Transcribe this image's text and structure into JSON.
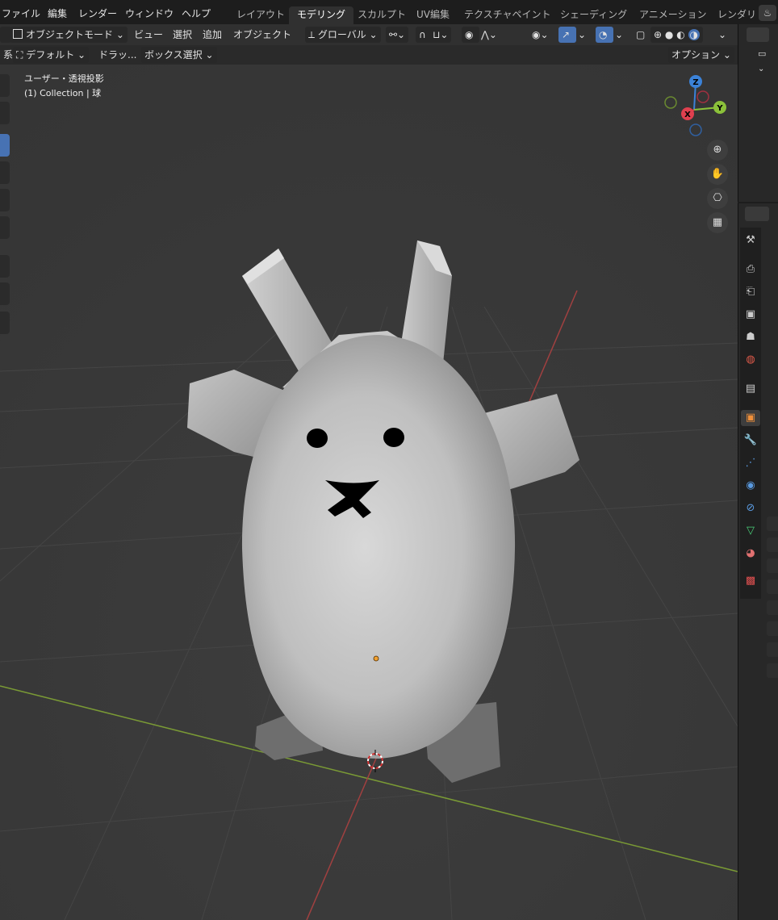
{
  "top_menu": {
    "items": [
      "ファイル",
      "編集",
      "レンダー",
      "ウィンドウ",
      "ヘルプ"
    ],
    "workspaces": [
      "レイアウト",
      "モデリング",
      "スカルプト",
      "UV編集",
      "テクスチャペイント",
      "シェーディング",
      "アニメーション",
      "レンダリ"
    ],
    "active_workspace": 1
  },
  "header": {
    "mode": "オブジェクトモード",
    "menus": [
      "ビュー",
      "選択",
      "追加",
      "オブジェクト"
    ],
    "transform_orientation": "グローバル"
  },
  "tool_settings": {
    "orientation_prefix": "系:",
    "orientation_value": "デフォルト",
    "drag_label": "ドラッ...",
    "drag_value": "ボックス選択",
    "options_label": "オプション"
  },
  "viewport": {
    "view_name": "ユーザー・透視投影",
    "collection_info": "(1) Collection | 球",
    "gizmo": {
      "z": "Z",
      "y": "Y",
      "x": "X"
    }
  },
  "colors": {
    "x_axis": "#e0404f",
    "y_axis": "#8bc13a",
    "z_axis": "#3b82d8",
    "accent": "#4772b3",
    "origin": "#f0a030"
  }
}
